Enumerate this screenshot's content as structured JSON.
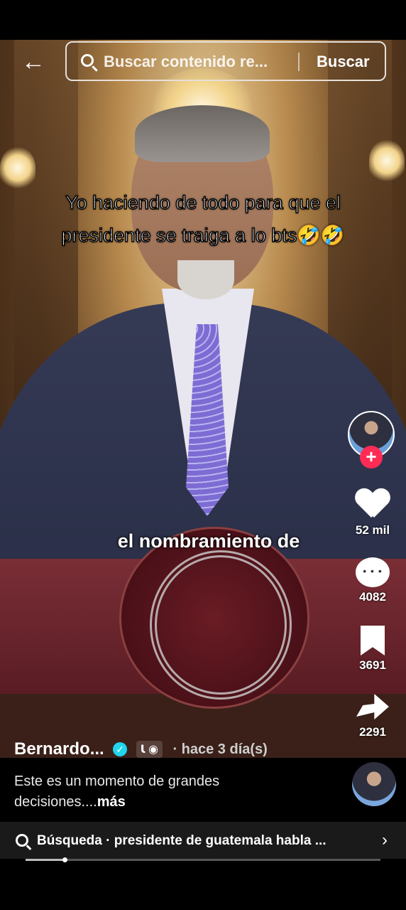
{
  "search": {
    "placeholder": "Buscar contenido re...",
    "button_label": "Buscar"
  },
  "video": {
    "overlay_caption": "Yo haciendo de todo para que el presidente se traiga a lo bts🤣🤣",
    "subtitle": "el nombramiento de"
  },
  "actions": {
    "likes": "52 mil",
    "comments": "4082",
    "saves": "3691",
    "shares": "2291"
  },
  "post": {
    "author": "Bernardo...",
    "badges": "Ꙇ ◉",
    "time": "· hace 3 día(s)",
    "description": "Este es un momento de grandes decisiones....",
    "more": "más"
  },
  "related": {
    "text": "Búsqueda · presidente de guatemala habla ..."
  },
  "progress": {
    "fraction": 0.11
  },
  "colors": {
    "follow": "#fe2c55",
    "verified": "#20d5ec"
  },
  "icons": [
    "back-arrow-icon",
    "search-icon",
    "plus-icon",
    "heart-icon",
    "comment-icon",
    "bookmark-icon",
    "share-icon",
    "verified-icon",
    "chevron-right-icon"
  ]
}
